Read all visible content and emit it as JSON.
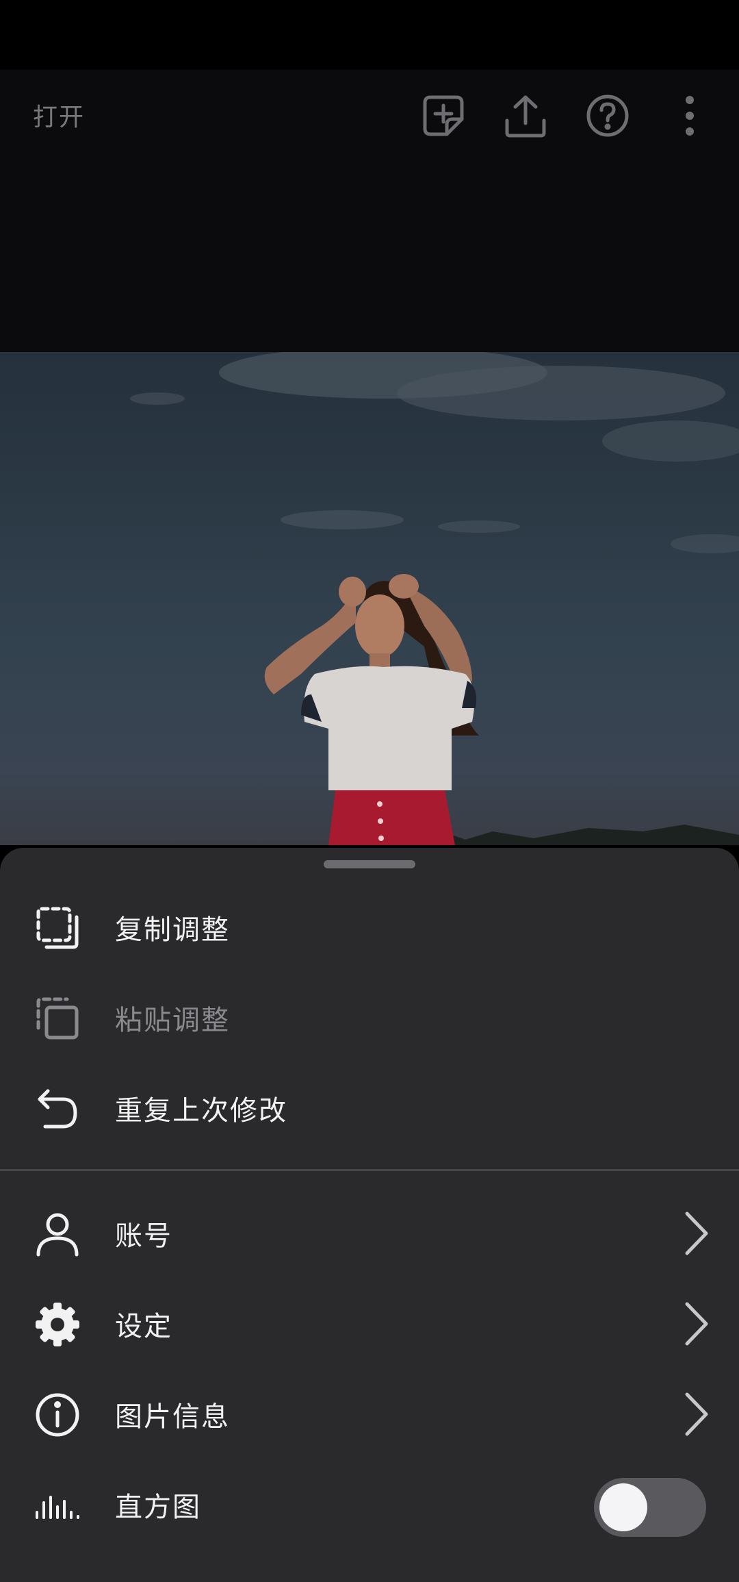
{
  "header": {
    "open_label": "打开",
    "icons": [
      "add-file-icon",
      "share-icon",
      "help-icon",
      "more-vert-icon"
    ]
  },
  "menu": {
    "items": [
      {
        "label": "复制调整",
        "icon": "copy-adjustments-icon",
        "enabled": true
      },
      {
        "label": "粘贴调整",
        "icon": "paste-adjustments-icon",
        "enabled": false
      },
      {
        "label": "重复上次修改",
        "icon": "undo-arrow-icon",
        "enabled": true
      },
      {
        "label": "账号",
        "icon": "person-icon",
        "chevron": true
      },
      {
        "label": "设定",
        "icon": "gear-icon",
        "chevron": true
      },
      {
        "label": "图片信息",
        "icon": "info-icon",
        "chevron": true
      },
      {
        "label": "直方图",
        "icon": "histogram-icon",
        "toggle": false
      }
    ]
  },
  "colors": {
    "sheet_bg": "#2a2a2d",
    "text": "#f2f2f2",
    "disabled_text": "#8a8a8e",
    "toolbar_icon": "#6e6e72"
  }
}
